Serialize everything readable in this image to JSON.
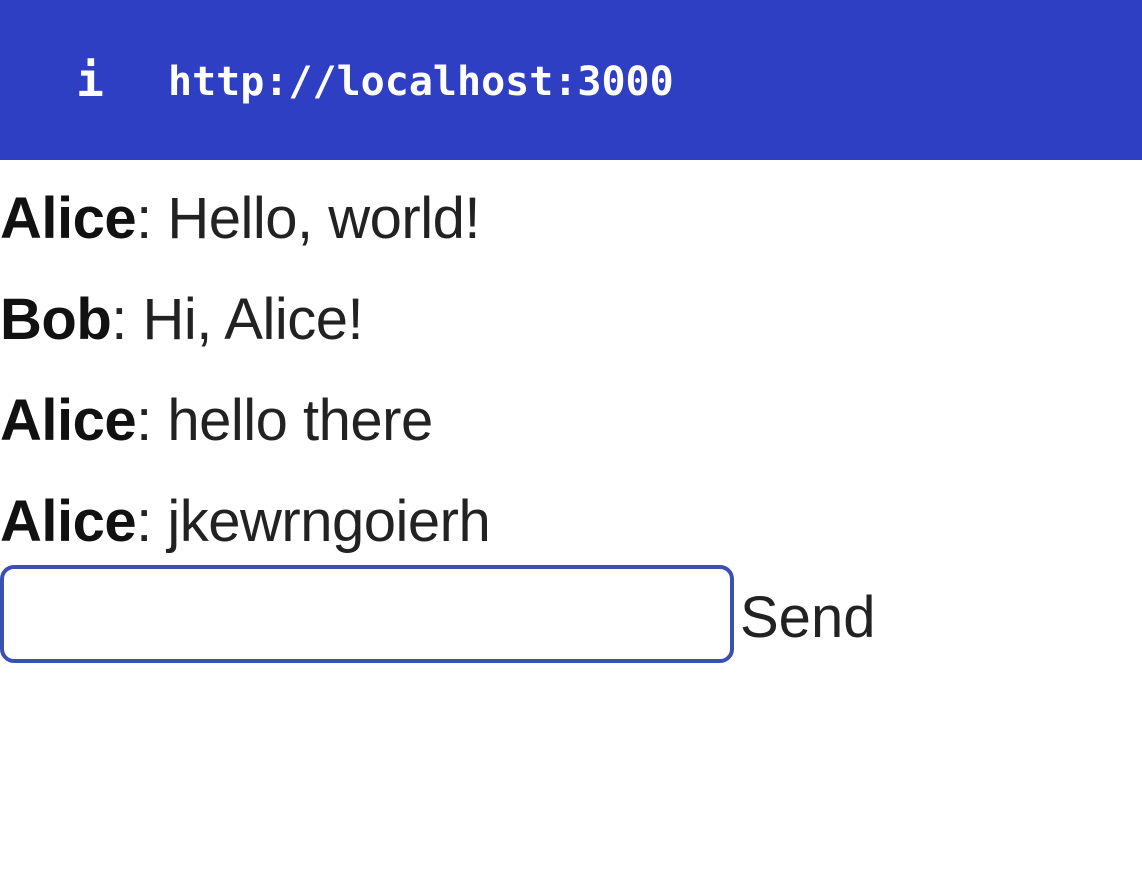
{
  "browser_bar": {
    "info_icon": "i",
    "url": "http://localhost:3000",
    "background_color": "#2f3fc4"
  },
  "messages": [
    {
      "author": "Alice",
      "separator": ": ",
      "text": "Hello, world!"
    },
    {
      "author": "Bob",
      "separator": ": ",
      "text": "Hi, Alice!"
    },
    {
      "author": "Alice",
      "separator": ": ",
      "text": "hello there"
    },
    {
      "author": "Alice",
      "separator": ": ",
      "text": "jkewrngoierh"
    }
  ],
  "composer": {
    "input_value": "",
    "input_placeholder": "",
    "send_label": "Send",
    "input_border_color": "#3c4fb3"
  }
}
